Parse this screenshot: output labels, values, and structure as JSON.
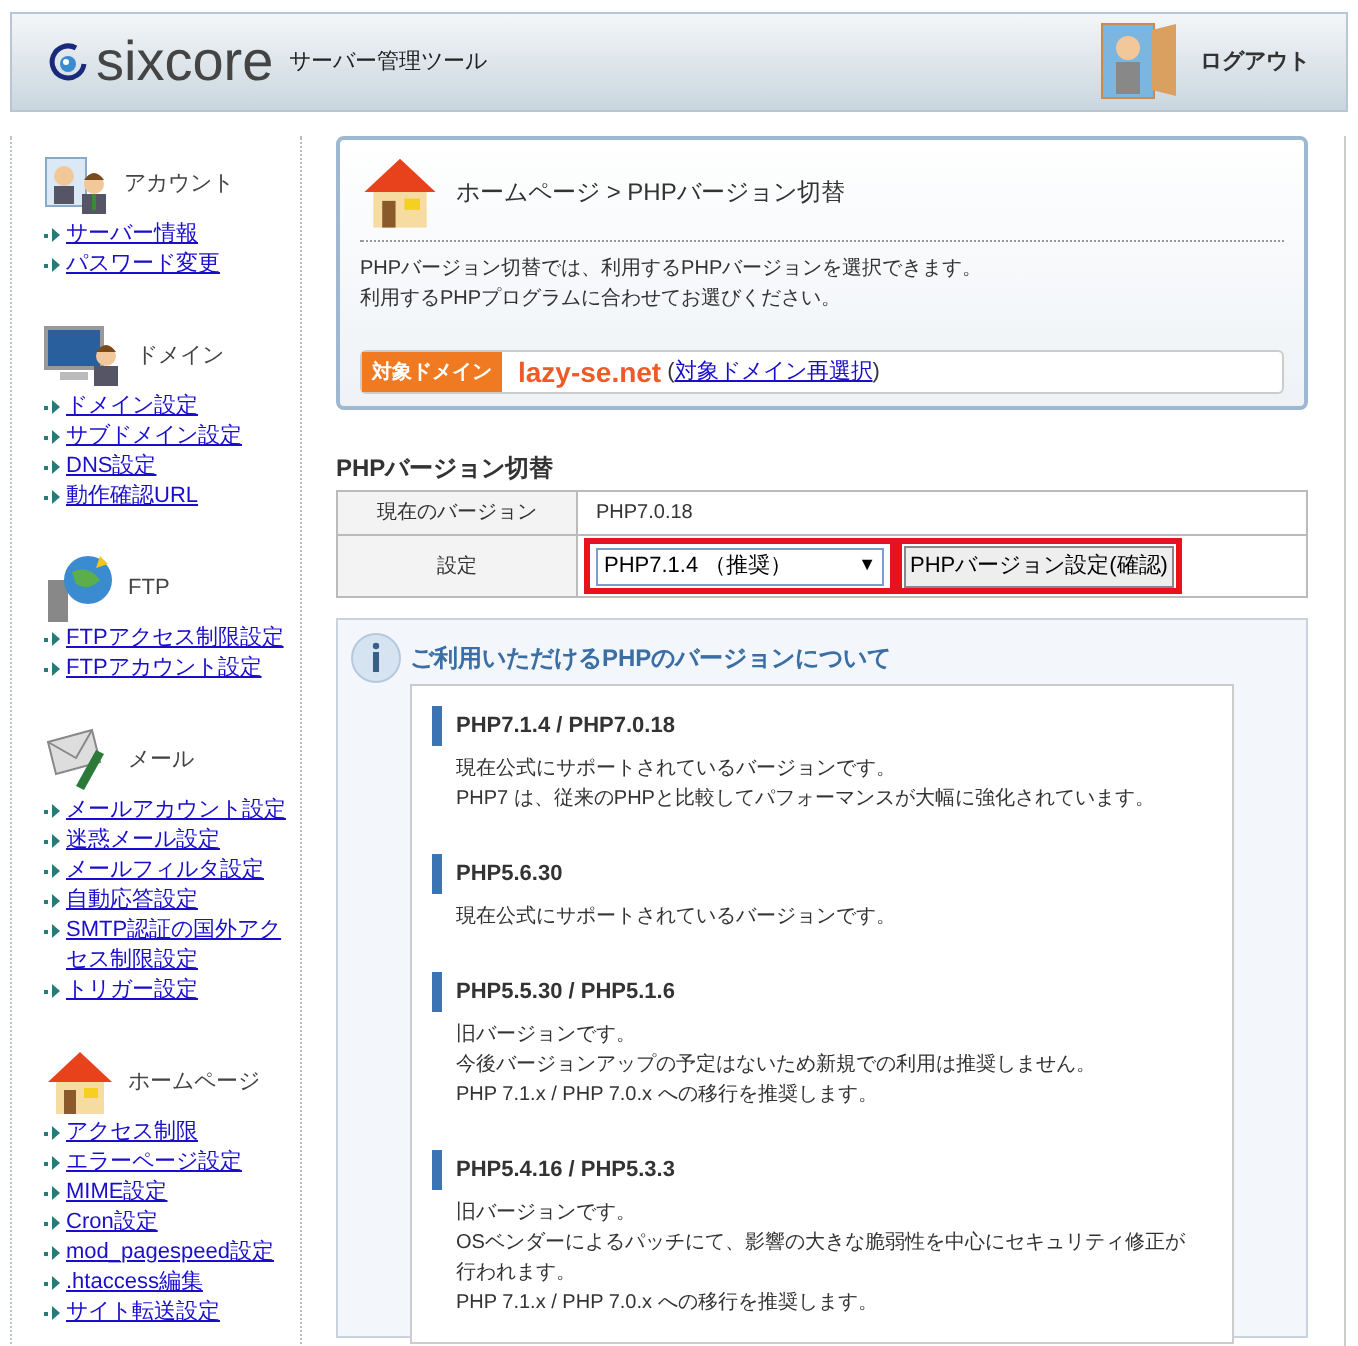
{
  "header": {
    "logo": "sixcore",
    "subtitle": "サーバー管理ツール",
    "logout": "ログアウト"
  },
  "sidebar": {
    "sections": [
      {
        "kind": "account",
        "title": "アカウント",
        "links": [
          "サーバー情報",
          "パスワード変更"
        ]
      },
      {
        "kind": "domain",
        "title": "ドメイン",
        "links": [
          "ドメイン設定",
          "サブドメイン設定",
          "DNS設定",
          "動作確認URL"
        ]
      },
      {
        "kind": "ftp",
        "title": "FTP",
        "links": [
          "FTPアクセス制限設定",
          "FTPアカウント設定"
        ]
      },
      {
        "kind": "mail",
        "title": "メール",
        "links": [
          "メールアカウント設定",
          "迷惑メール設定",
          "メールフィルタ設定",
          "自動応答設定",
          "SMTP認証の国外アクセス制限設定",
          "トリガー設定"
        ]
      },
      {
        "kind": "homepage",
        "title": "ホームページ",
        "links": [
          "アクセス制限",
          "エラーページ設定",
          "MIME設定",
          "Cron設定",
          "mod_pagespeed設定",
          ".htaccess編集",
          "サイト転送設定"
        ]
      }
    ]
  },
  "page_header": {
    "breadcrumb": "ホームページ > PHPバージョン切替",
    "description": [
      "PHPバージョン切替では、利用するPHPバージョンを選択できます。",
      "利用するPHPプログラムに合わせてお選びください。"
    ],
    "domain_label": "対象ドメイン",
    "domain": "lazy-se.net",
    "paren_open": "(",
    "domain_link": "対象ドメイン再選択",
    "paren_close": ")"
  },
  "settings": {
    "heading": "PHPバージョン切替",
    "current_label": "現在のバージョン",
    "current_value": "PHP7.0.18",
    "setting_label": "設定",
    "select_value": "PHP7.1.4 （推奨）",
    "select_arrow": "▼",
    "submit": "PHPバージョン設定(確認)"
  },
  "info": {
    "title": "ご利用いただけるPHPのバージョンについて",
    "entries": [
      {
        "heading": "PHP7.1.4 / PHP7.0.18",
        "lines": [
          "現在公式にサポートされているバージョンです。",
          "PHP7 は、従来のPHPと比較してパフォーマンスが大幅に強化されています。"
        ]
      },
      {
        "heading": "PHP5.6.30",
        "lines": [
          "現在公式にサポートされているバージョンです。"
        ]
      },
      {
        "heading": "PHP5.5.30 / PHP5.1.6",
        "lines": [
          "旧バージョンです。",
          "今後バージョンアップの予定はないため新規での利用は推奨しません。",
          "PHP 7.1.x / PHP 7.0.x への移行を推奨します。"
        ]
      },
      {
        "heading": "PHP5.4.16 / PHP5.3.3",
        "lines": [
          "旧バージョンです。",
          "OSベンダーによるパッチにて、影響の大きな脆弱性を中心にセキュリティ修正が行われます。",
          "PHP 7.1.x / PHP 7.0.x への移行を推奨します。"
        ]
      }
    ]
  }
}
